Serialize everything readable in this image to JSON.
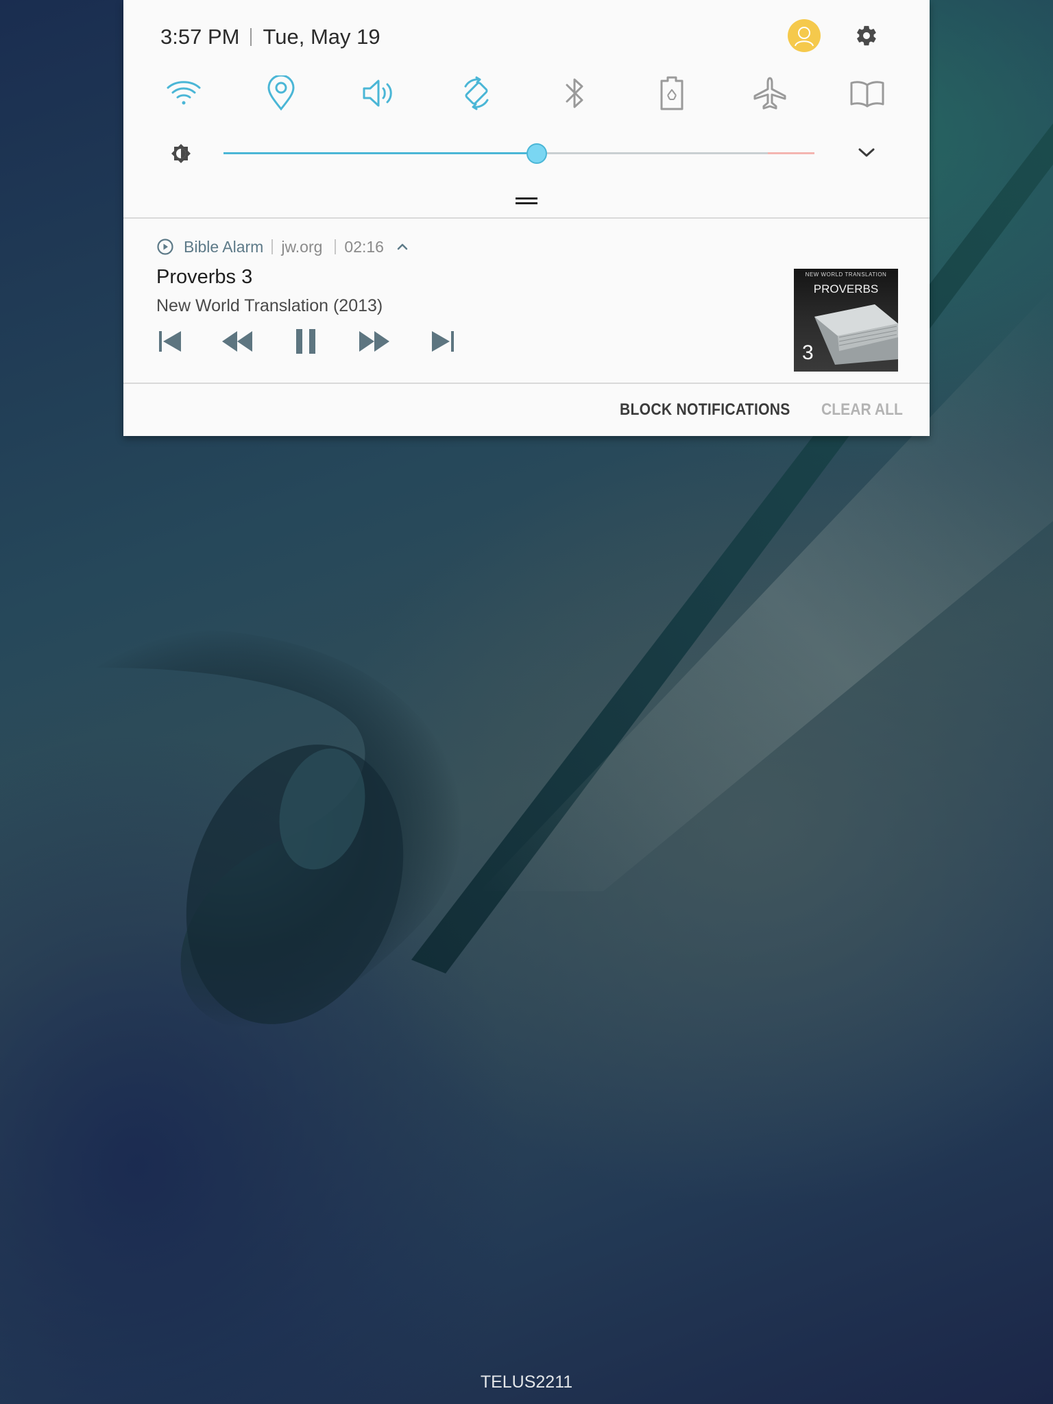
{
  "quick_settings": {
    "time": "3:57 PM",
    "date": "Tue, May 19",
    "toggles": [
      {
        "name": "Wi-Fi",
        "icon": "wifi-icon",
        "active": true
      },
      {
        "name": "Location",
        "icon": "location-icon",
        "active": true
      },
      {
        "name": "Sound",
        "icon": "sound-icon",
        "active": true
      },
      {
        "name": "Auto rotate",
        "icon": "auto-rotate-icon",
        "active": true
      },
      {
        "name": "Bluetooth",
        "icon": "bluetooth-icon",
        "active": false
      },
      {
        "name": "Power saving",
        "icon": "power-saving-icon",
        "active": false
      },
      {
        "name": "Airplane mode",
        "icon": "airplane-icon",
        "active": false
      },
      {
        "name": "Reading mode",
        "icon": "book-icon",
        "active": false
      }
    ],
    "brightness_level": 0.53,
    "colors": {
      "active": "#4ab6d6",
      "inactive": "#9a9a9a",
      "avatar": "#f5c94c"
    }
  },
  "notification": {
    "app_name": "Bible Alarm",
    "source": "jw.org",
    "elapsed": "02:16",
    "title": "Proverbs 3",
    "subtitle": "New World Translation (2013)",
    "album_art": {
      "series": "NEW WORLD TRANSLATION",
      "book": "PROVERBS",
      "chapter": "3"
    },
    "controls": [
      "skip-previous-icon",
      "rewind-icon",
      "pause-icon",
      "fast-forward-icon",
      "skip-next-icon"
    ]
  },
  "actions": {
    "block_label": "BLOCK NOTIFICATIONS",
    "clear_label": "CLEAR ALL"
  },
  "carrier": "TELUS2211"
}
